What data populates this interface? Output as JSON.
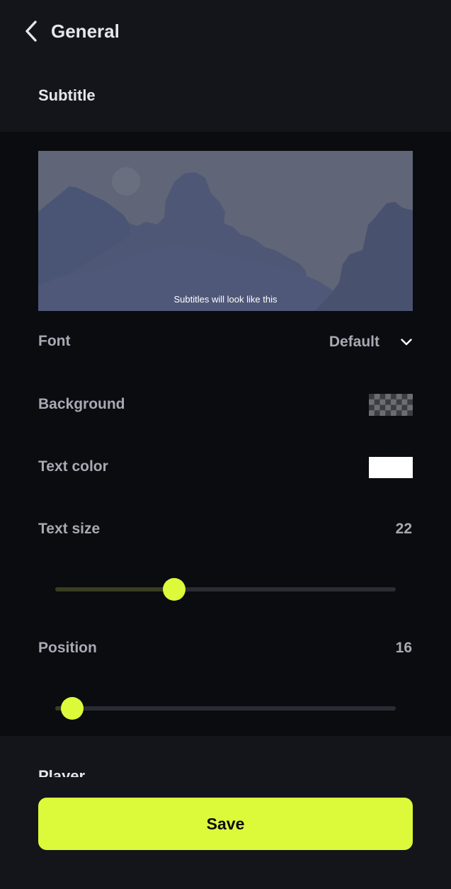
{
  "header": {
    "title": "General",
    "back_icon": "chevron-left-icon"
  },
  "subtitle_section": {
    "title": "Subtitle",
    "preview_caption": "Subtitles will look like this",
    "font": {
      "label": "Font",
      "value": "Default",
      "icon": "chevron-down-icon"
    },
    "background": {
      "label": "Background",
      "swatch": "transparent-checkerboard"
    },
    "text_color": {
      "label": "Text color",
      "swatch": "#ffffff"
    },
    "text_size": {
      "label": "Text size",
      "value": "22",
      "slider_fraction": 0.35
    },
    "position": {
      "label": "Position",
      "value": "16",
      "slider_fraction": 0.05
    }
  },
  "player_section": {
    "title": "Player"
  },
  "footer": {
    "save_label": "Save"
  },
  "colors": {
    "accent": "#dcfa3a",
    "background": "#13151b",
    "panel": "#0b0c0f"
  }
}
